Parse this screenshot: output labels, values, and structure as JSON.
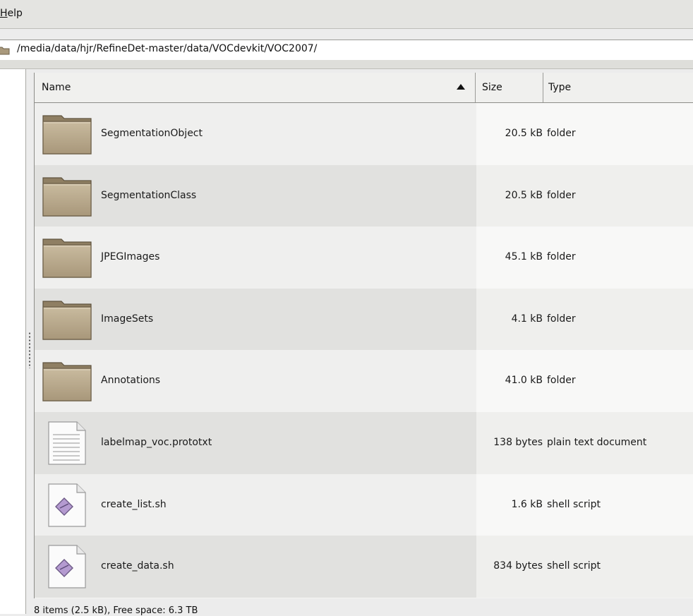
{
  "menubar": {
    "help_label_prefix": "",
    "help_label_underlined": "H",
    "help_label_rest": "elp"
  },
  "location": {
    "path": "/media/data/hjr/RefineDet-master/data/VOCdevkit/VOC2007/"
  },
  "columns": {
    "name": "Name",
    "size": "Size",
    "type": "Type"
  },
  "files": [
    {
      "name": "SegmentationObject",
      "size": "20.5 kB",
      "type": "folder",
      "icon": "folder-icon"
    },
    {
      "name": "SegmentationClass",
      "size": "20.5 kB",
      "type": "folder",
      "icon": "folder-icon"
    },
    {
      "name": "JPEGImages",
      "size": "45.1 kB",
      "type": "folder",
      "icon": "folder-icon"
    },
    {
      "name": "ImageSets",
      "size": "4.1 kB",
      "type": "folder",
      "icon": "folder-icon"
    },
    {
      "name": "Annotations",
      "size": "41.0 kB",
      "type": "folder",
      "icon": "folder-icon"
    },
    {
      "name": "labelmap_voc.prototxt",
      "size": "138 bytes",
      "type": "plain text document",
      "icon": "text-document-icon"
    },
    {
      "name": "create_list.sh",
      "size": "1.6 kB",
      "type": "shell script",
      "icon": "shell-script-icon"
    },
    {
      "name": "create_data.sh",
      "size": "834 bytes",
      "type": "shell script",
      "icon": "shell-script-icon"
    }
  ],
  "statusbar": {
    "text": "8 items (2.5 kB), Free space: 6.3 TB"
  },
  "colors": {
    "folder": "#b8a88c",
    "selection_none": "#efefee"
  }
}
